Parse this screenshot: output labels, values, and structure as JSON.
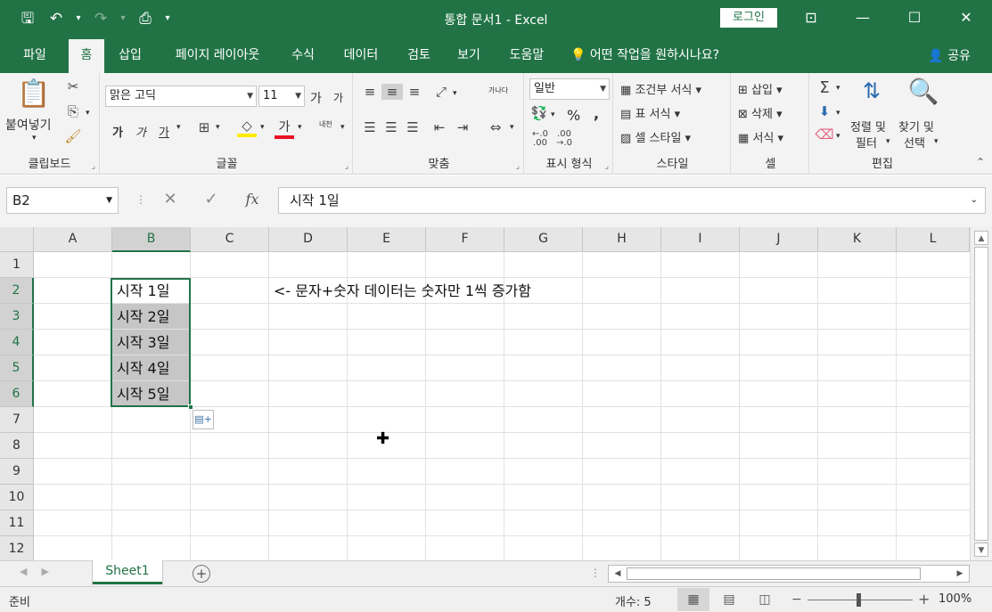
{
  "window": {
    "title": "통합 문서1  -  Excel",
    "login_label": "로그인"
  },
  "tabs": [
    "파일",
    "홈",
    "삽입",
    "페이지 레이아웃",
    "수식",
    "데이터",
    "검토",
    "보기",
    "도움말"
  ],
  "active_tab": "홈",
  "tell_me": "어떤 작업을 원하시나요?",
  "share_label": "공유",
  "ribbon": {
    "clipboard": {
      "label": "클립보드",
      "paste": "붙여넣기"
    },
    "font": {
      "label": "글꼴",
      "name": "맑은 고딕",
      "size": "11",
      "grow": "가",
      "shrink": "가",
      "bold": "가",
      "italic": "가",
      "underline": "가",
      "color_char": "가",
      "phonetic": "내천"
    },
    "alignment": {
      "label": "맞춤",
      "wrap": "가나다"
    },
    "number": {
      "label": "표시 형식",
      "format": "일반",
      "percent": "%",
      "comma": ",",
      "inc_dec": ".0\n.00",
      "dec_dec": ".00\n→.0"
    },
    "styles": {
      "label": "스타일",
      "conditional": "조건부 서식",
      "table": "표 서식",
      "cell": "셀 스타일"
    },
    "cells": {
      "label": "셀",
      "insert": "삽입",
      "delete": "삭제",
      "format": "서식"
    },
    "editing": {
      "label": "편집",
      "sort_1": "정렬 및",
      "sort_2": "필터",
      "find_1": "찾기 및",
      "find_2": "선택"
    }
  },
  "formula_bar": {
    "name_box": "B2",
    "content": "시작 1일"
  },
  "sheet": {
    "columns": [
      "A",
      "B",
      "C",
      "D",
      "E",
      "F",
      "G",
      "H",
      "I",
      "J",
      "K",
      "L"
    ],
    "rows": [
      "1",
      "2",
      "3",
      "4",
      "5",
      "6",
      "7",
      "8",
      "9",
      "10",
      "11",
      "12"
    ],
    "selected_column": "B",
    "cells": {
      "B2": "시작 1일",
      "B3": "시작 2일",
      "B4": "시작 3일",
      "B5": "시작 4일",
      "B6": "시작 5일",
      "D2": "<- 문자+숫자 데이터는 숫자만 1씩 증가함"
    }
  },
  "sheet_tabs": [
    "Sheet1"
  ],
  "status": {
    "ready": "준비",
    "count": "개수: 5",
    "zoom": "100%"
  },
  "colors": {
    "accent": "#217346",
    "selection_fill": "#c6c6c6"
  }
}
